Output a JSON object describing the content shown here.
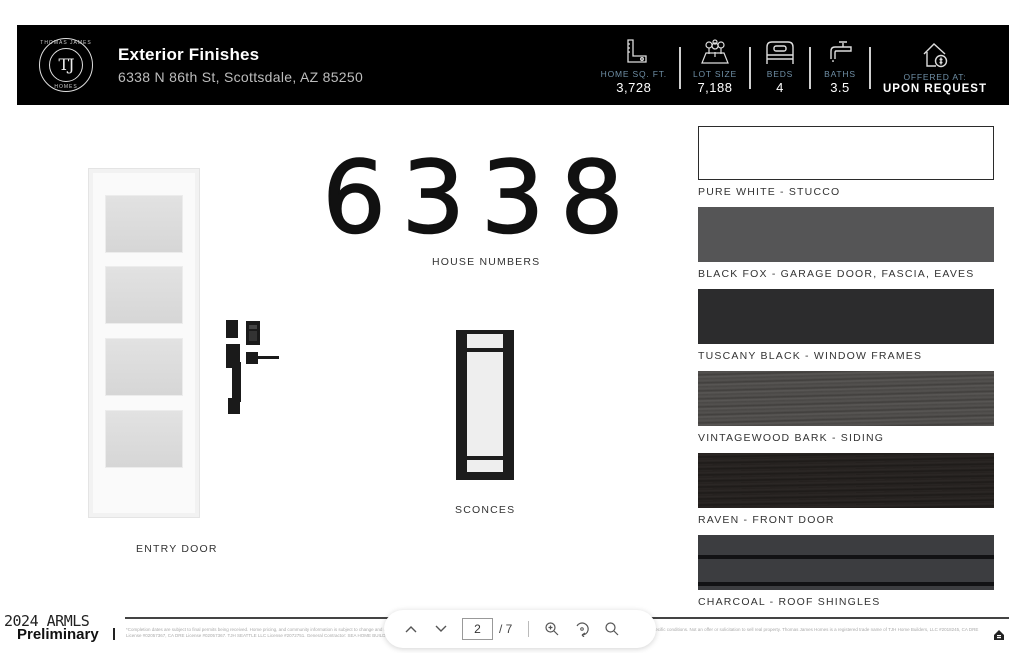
{
  "header": {
    "logo": {
      "brand_top": "THOMAS JAMES",
      "monogram": "TJ",
      "brand_bottom": "HOMES"
    },
    "title": "Exterior Finishes",
    "address": "6338 N 86th St, Scottsdale, AZ 85250",
    "stats": [
      {
        "icon": "ruler-square-icon",
        "label": "HOME SQ. FT.",
        "value": "3,728"
      },
      {
        "icon": "lot-map-icon",
        "label": "LOT SIZE",
        "value": "7,188"
      },
      {
        "icon": "bed-icon",
        "label": "BEDS",
        "value": "4"
      },
      {
        "icon": "faucet-icon",
        "label": "BATHS",
        "value": "3.5"
      },
      {
        "icon": "house-dollar-icon",
        "label": "OFFERED AT:",
        "value": "UPON REQUEST"
      }
    ]
  },
  "products": {
    "house_number_digits": [
      "6",
      "3",
      "3",
      "8"
    ],
    "entry_door_caption": "ENTRY DOOR",
    "house_numbers_caption": "HOUSE NUMBERS",
    "sconces_caption": "SCONCES"
  },
  "swatches": [
    {
      "label": "PURE WHITE - STUCCO",
      "color": "#ffffff"
    },
    {
      "label": "BLACK FOX - GARAGE DOOR, FASCIA, EAVES",
      "color": "#555556"
    },
    {
      "label": "TUSCANY BLACK - WINDOW FRAMES",
      "color": "#2c2c2d"
    },
    {
      "label": "VINTAGEWOOD BARK - SIDING",
      "color": "#4b4947"
    },
    {
      "label": "RAVEN - FRONT DOOR",
      "color": "#231f1d"
    },
    {
      "label": "CHARCOAL - ROOF SHINGLES",
      "color": "#3c3d40"
    }
  ],
  "footer": {
    "watermark_top": "2024 ARMLS",
    "watermark_bottom": "Preliminary",
    "fine_print": "*Completion dates are subject to final permits being received. Home pricing, and community information is subject to change and may vary in construction and depending on the standard of measurement used, engineering and municipal requirements, or other site specific conditions. Not an offer or solicitation to sell real property. Thomas James Homes is a registered trade name of TJH Home Builders, LLC #2018245, CA DRE License #02057367, CA DRE License #02057367. TJH SEATTLE LLC License #2072751. General Contractor: SEA HOME BUILDERS LLC, License # SEAHOHB800DO."
  },
  "pdf_toolbar": {
    "current_page": "2",
    "total_pages": "/ 7",
    "prev_label": "Previous page",
    "next_label": "Next page",
    "zoom_in_label": "Zoom in",
    "rotate_label": "Rotate",
    "search_label": "Search"
  }
}
